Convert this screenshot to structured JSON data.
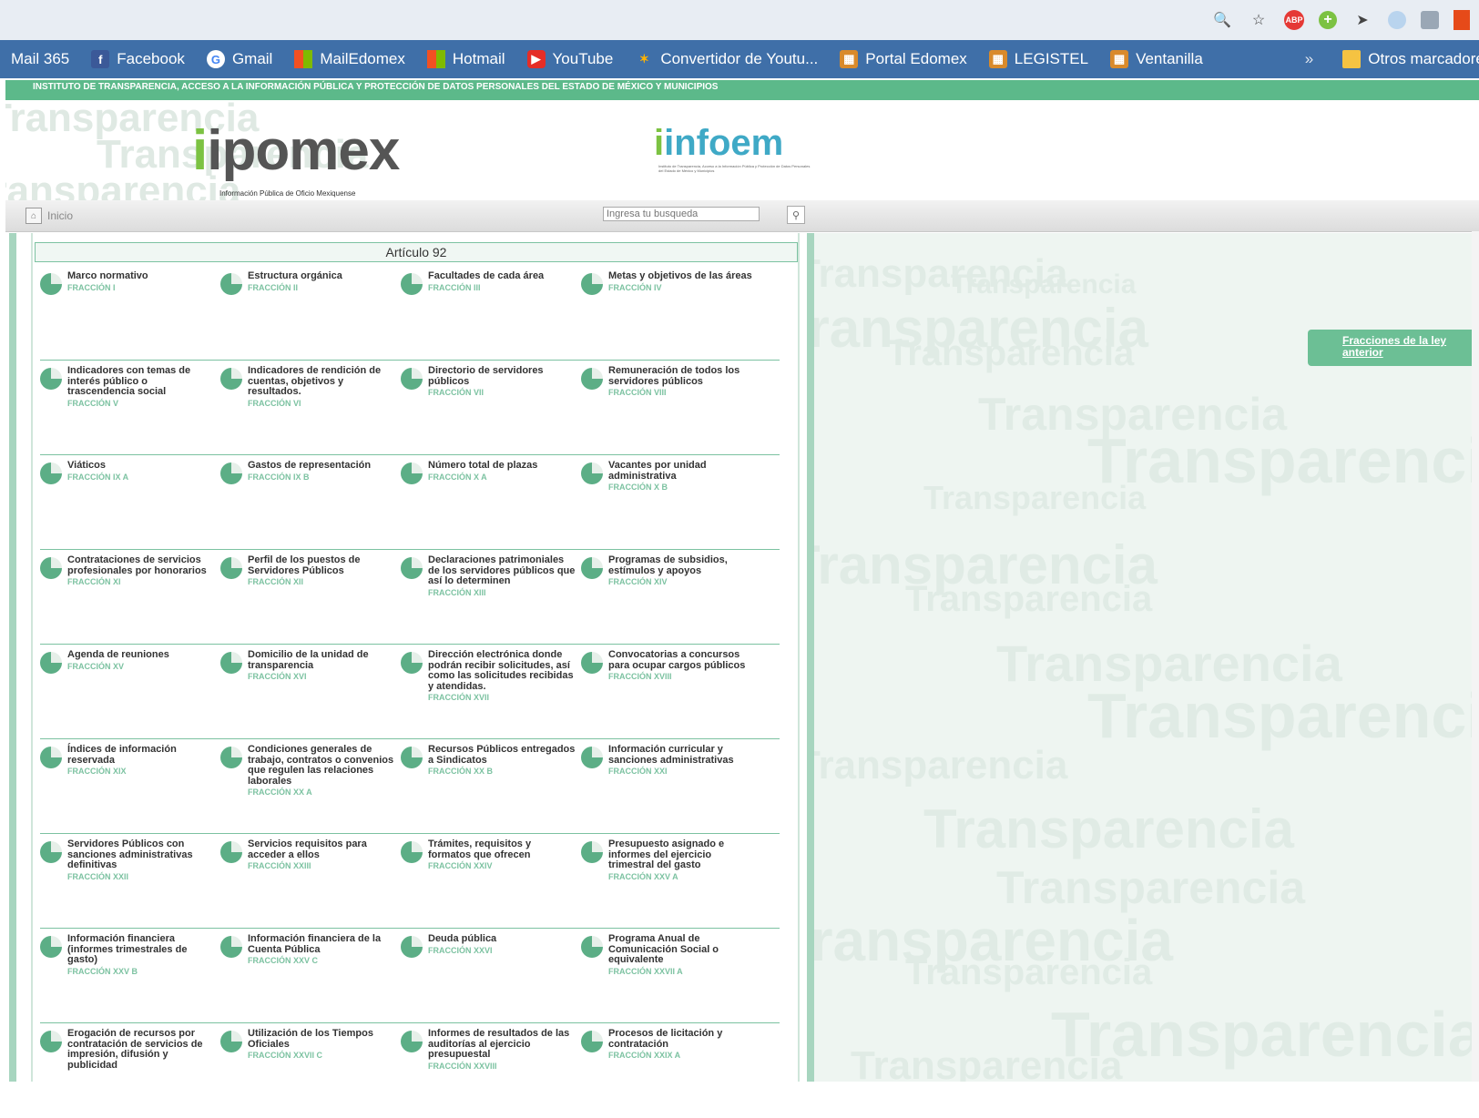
{
  "browser": {
    "bookmarks": [
      {
        "label": "Mail 365",
        "icon": "none"
      },
      {
        "label": "Facebook",
        "icon": "facebook-icon"
      },
      {
        "label": "Gmail",
        "icon": "google-icon"
      },
      {
        "label": "MailEdomex",
        "icon": "microsoft-icon"
      },
      {
        "label": "Hotmail",
        "icon": "microsoft-icon"
      },
      {
        "label": "YouTube",
        "icon": "youtube-icon"
      },
      {
        "label": "Convertidor de Youtu...",
        "icon": "converter-icon"
      },
      {
        "label": "Portal Edomex",
        "icon": "bookmark-site-icon"
      },
      {
        "label": "LEGISTEL",
        "icon": "bookmark-site-icon"
      },
      {
        "label": "Ventanilla",
        "icon": "bookmark-site-icon"
      }
    ],
    "more_label": "»",
    "other_bookmarks": "Otros marcadores",
    "abp_label": "ABP"
  },
  "site": {
    "institute": "INSTITUTO DE TRANSPARENCIA, ACCESO A LA INFORMACIÓN PÚBLICA Y PROTECCIÓN DE DATOS PERSONALES DEL ESTADO DE MÉXICO Y MUNICIPIOS",
    "ipomex_logo": "ipomex",
    "ipomex_sub": "Información Pública de Oficio Mexiquense",
    "infoem_logo": "infoem",
    "infoem_sub": "Instituto de Transparencia, Acceso a la Información Pública y Protección de Datos Personales del Estado de México y Municipios",
    "bg_word": "Transparencia"
  },
  "nav": {
    "home_label": "Inicio",
    "search_placeholder": "Ingresa tu busqueda"
  },
  "article": {
    "title": "Artículo 92",
    "rows": [
      [
        {
          "title": "Marco normativo",
          "frac": "FRACCIÓN I"
        },
        {
          "title": "Estructura orgánica",
          "frac": "FRACCIÓN II"
        },
        {
          "title": "Facultades de cada área",
          "frac": "FRACCIÓN III"
        },
        {
          "title": "Metas y objetivos de las áreas",
          "frac": "FRACCIÓN IV"
        }
      ],
      [
        {
          "title": "Indicadores con temas de interés público o trascendencia social",
          "frac": "FRACCIÓN V"
        },
        {
          "title": "Indicadores de rendición de cuentas, objetivos y resultados.",
          "frac": "FRACCIÓN VI"
        },
        {
          "title": "Directorio de servidores públicos",
          "frac": "FRACCIÓN VII"
        },
        {
          "title": "Remuneración de todos los servidores públicos",
          "frac": "FRACCIÓN VIII"
        }
      ],
      [
        {
          "title": "Viáticos",
          "frac": "FRACCIÓN IX A"
        },
        {
          "title": "Gastos de representación",
          "frac": "FRACCIÓN IX B"
        },
        {
          "title": "Número total de plazas",
          "frac": "FRACCIÓN X A"
        },
        {
          "title": "Vacantes por unidad administrativa",
          "frac": "FRACCIÓN X B"
        }
      ],
      [
        {
          "title": "Contrataciones de servicios profesionales por honorarios",
          "frac": "FRACCIÓN XI"
        },
        {
          "title": "Perfil de los puestos de Servidores Públicos",
          "frac": "FRACCIÓN XII"
        },
        {
          "title": "Declaraciones patrimoniales de los servidores públicos que así lo determinen",
          "frac": "FRACCIÓN XIII"
        },
        {
          "title": "Programas de subsidios, estímulos y apoyos",
          "frac": "FRACCIÓN XIV"
        }
      ],
      [
        {
          "title": "Agenda de reuniones",
          "frac": "FRACCIÓN XV"
        },
        {
          "title": "Domicilio de la unidad de transparencia",
          "frac": "FRACCIÓN XVI"
        },
        {
          "title": "Dirección electrónica donde podrán recibir solicitudes, así como las solicitudes recibidas y atendidas.",
          "frac": "FRACCIÓN XVII"
        },
        {
          "title": "Convocatorias a concursos para ocupar cargos públicos",
          "frac": "FRACCIÓN XVIII"
        }
      ],
      [
        {
          "title": "Índices de información reservada",
          "frac": "FRACCIÓN XIX"
        },
        {
          "title": "Condiciones generales de trabajo, contratos o convenios que regulen las relaciones laborales",
          "frac": "FRACCIÓN XX A"
        },
        {
          "title": "Recursos Públicos entregados a Sindicatos",
          "frac": "FRACCIÓN XX B"
        },
        {
          "title": "Información curricular y sanciones administrativas",
          "frac": "FRACCIÓN XXI"
        }
      ],
      [
        {
          "title": "Servidores Públicos con sanciones administrativas definitivas",
          "frac": "FRACCIÓN XXII"
        },
        {
          "title": "Servicios requisitos para acceder a ellos",
          "frac": "FRACCIÓN XXIII"
        },
        {
          "title": "Trámites, requisitos y formatos que ofrecen",
          "frac": "FRACCIÓN XXIV"
        },
        {
          "title": "Presupuesto asignado e informes del ejercicio trimestral del gasto",
          "frac": "FRACCIÓN XXV A"
        }
      ],
      [
        {
          "title": "Información financiera (informes trimestrales de gasto)",
          "frac": "FRACCIÓN XXV B"
        },
        {
          "title": "Información financiera de la Cuenta Pública",
          "frac": "FRACCIÓN XXV C"
        },
        {
          "title": "Deuda pública",
          "frac": "FRACCIÓN XXVI"
        },
        {
          "title": "Programa Anual de Comunicación Social o equivalente",
          "frac": "FRACCIÓN XXVII A"
        }
      ],
      [
        {
          "title": "Erogación de recursos por contratación de servicios de impresión, difusión y publicidad",
          "frac": ""
        },
        {
          "title": "Utilización de los Tiempos Oficiales",
          "frac": "FRACCIÓN XXVII C"
        },
        {
          "title": "Informes de resultados de las auditorías al ejercicio presupuestal",
          "frac": "FRACCIÓN XXVIII"
        },
        {
          "title": "Procesos de licitación y contratación",
          "frac": "FRACCIÓN XXIX A"
        }
      ]
    ]
  },
  "sidebar": {
    "prev_law_button": "Fracciones de la ley anterior"
  }
}
